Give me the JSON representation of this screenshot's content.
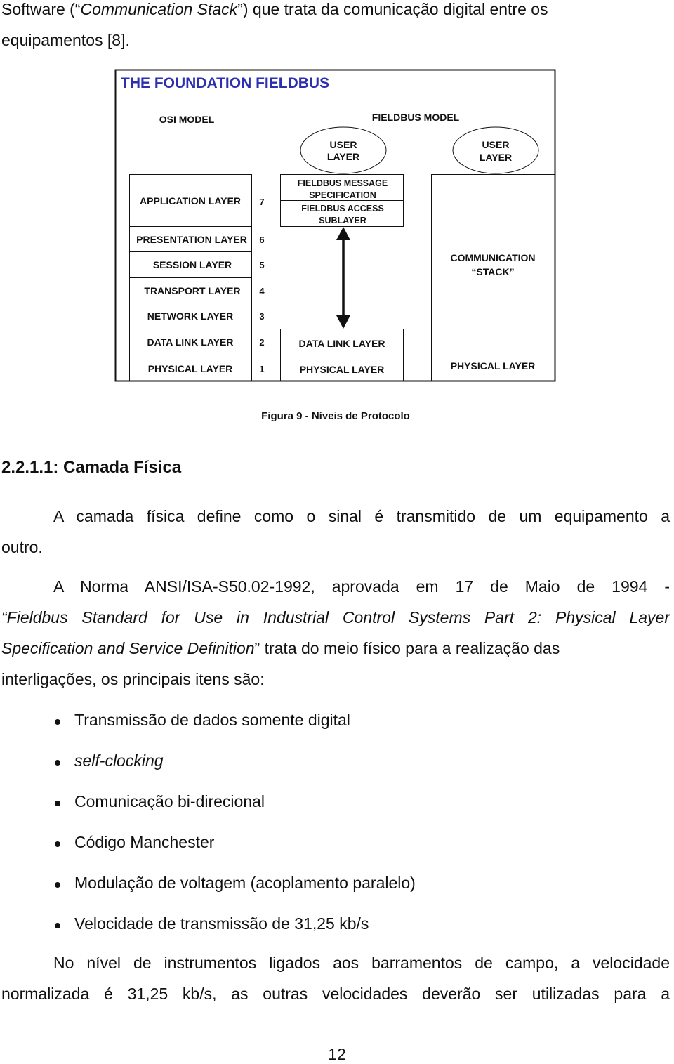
{
  "intro": {
    "line1_words": [
      "Software",
      "(“<i>Communication</i>",
      "<i>Stack</i>”)",
      "que",
      "trata",
      "da",
      "comunicação",
      "digital",
      "entre",
      "os"
    ],
    "line1_parts": {
      "prefix": "Software (“",
      "italic": "Communication Stack",
      "suffix": "”) que trata da comunicação digital entre os"
    },
    "line2": "equipamentos [8]."
  },
  "figure": {
    "title": "THE FOUNDATION FIELDBUS",
    "title_color": "#2b2fb0",
    "osi_heading": "OSI MODEL",
    "fieldbus_heading": "FIELDBUS MODEL",
    "osi_layers": [
      {
        "label": "APPLICATION LAYER",
        "number": "7"
      },
      {
        "label": "PRESENTATION LAYER",
        "number": "6"
      },
      {
        "label": "SESSION LAYER",
        "number": "5"
      },
      {
        "label": "TRANSPORT LAYER",
        "number": "4"
      },
      {
        "label": "NETWORK LAYER",
        "number": "3"
      },
      {
        "label": "DATA LINK LAYER",
        "number": "2"
      },
      {
        "label": "PHYSICAL LAYER",
        "number": "1"
      }
    ],
    "fieldbus_model": {
      "user_layer": [
        "USER",
        "LAYER"
      ],
      "fms": [
        "FIELDBUS MESSAGE",
        "SPECIFICATION"
      ],
      "fas": [
        "FIELDBUS ACCESS",
        "SUBLAYER"
      ],
      "data_link": "DATA LINK LAYER",
      "physical": "PHYSICAL LAYER"
    },
    "stack_model": {
      "user_layer": [
        "USER",
        "LAYER"
      ],
      "communication": [
        "COMMUNICATION",
        "“STACK”"
      ],
      "physical": "PHYSICAL LAYER"
    },
    "caption": "Figura 9 - Níveis de Protocolo"
  },
  "section": {
    "heading": "2.2.1.1: Camada Física",
    "para1_line1": "A camada física define como o sinal é transmitido de um equipamento a",
    "para1_line2": "outro.",
    "para2_line1": "A Norma ANSI/ISA-S50.02-1992, aprovada em 17 de Maio de 1994 -",
    "para2_line2_italic": "“Fieldbus Standard for Use in Industrial Control Systems Part 2: Physical Layer",
    "para2_line3_italic": "Specification and Service Definition",
    "para2_line3_rest": "” trata do meio físico para a realização das",
    "para2_line4": "interligações, os principais itens são:",
    "bullets": [
      {
        "text": "Transmissão de dados somente digital",
        "italic": false
      },
      {
        "text": "self-clocking",
        "italic": true
      },
      {
        "text": "Comunicação bi-direcional",
        "italic": false
      },
      {
        "text": "Código Manchester",
        "italic": false
      },
      {
        "text": "Modulação de voltagem (acoplamento paralelo)",
        "italic": false
      },
      {
        "text": "Velocidade de transmissão de 31,25 kb/s",
        "italic": false
      }
    ],
    "para3_line1": "No nível de instrumentos ligados aos barramentos de campo, a velocidade",
    "para3_line2": "normalizada é 31,25 kb/s, as outras velocidades deverão ser utilizadas para a"
  },
  "footer": {
    "page_number": "12"
  }
}
